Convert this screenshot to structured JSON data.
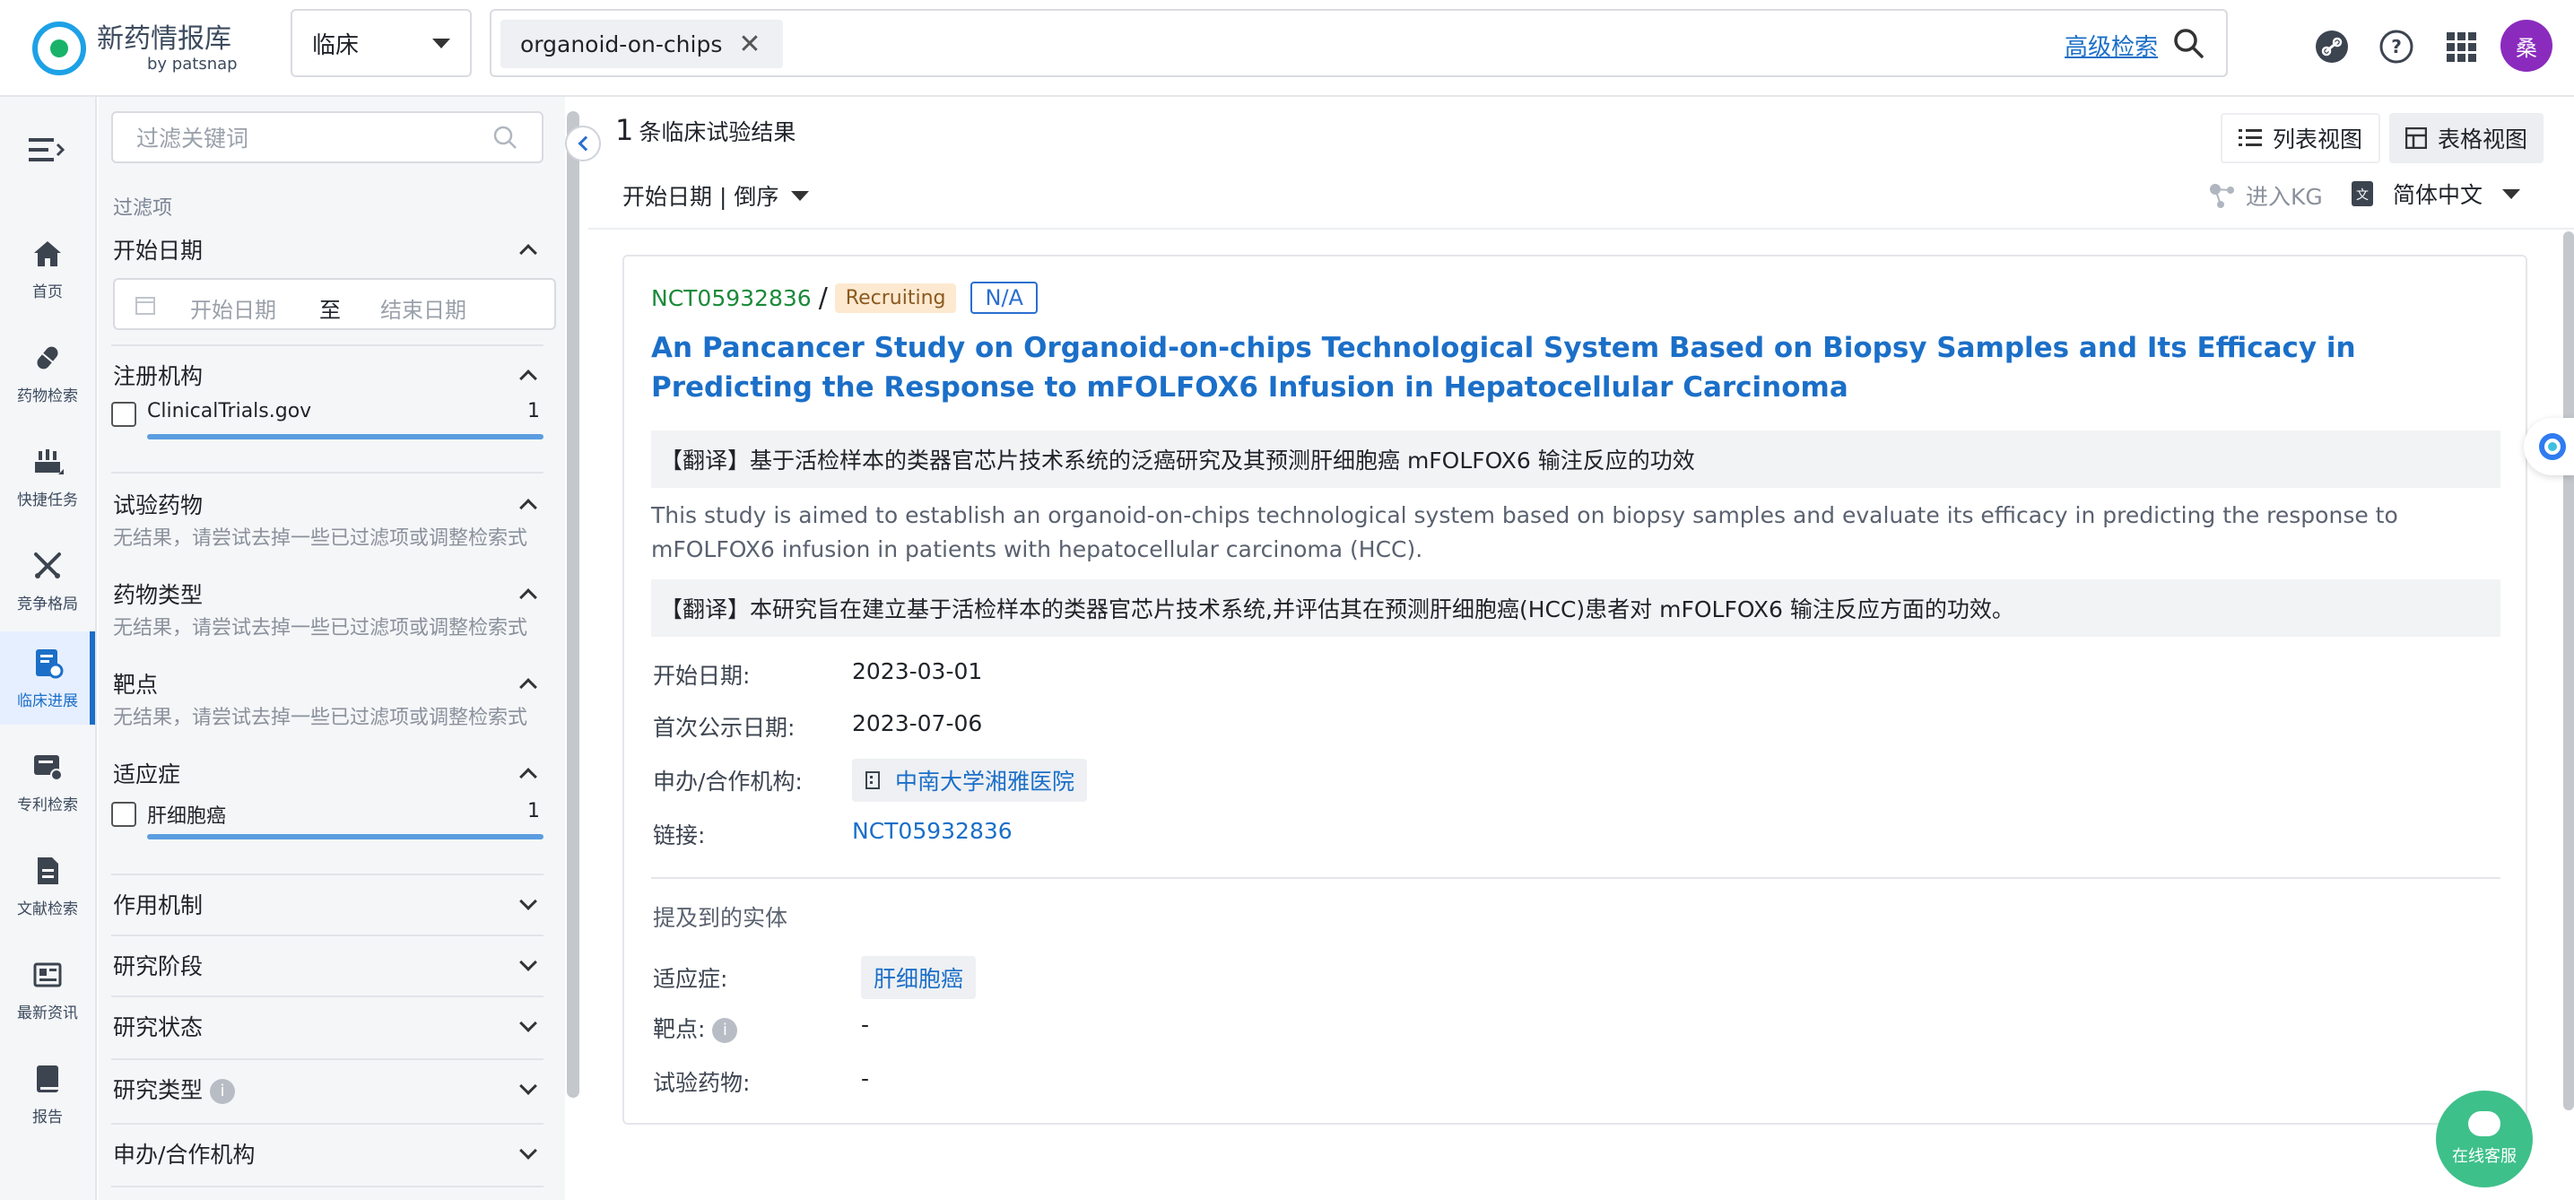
{
  "app": {
    "name": "新药情报库",
    "sub": "by patsnap"
  },
  "topbar": {
    "scope": "临床",
    "query_tag": "organoid-on-chips",
    "advanced_search": "高级检索",
    "avatar": "桑"
  },
  "nav": {
    "items": [
      {
        "label": "首页",
        "icon": "home-icon"
      },
      {
        "label": "药物检索",
        "icon": "pill-icon"
      },
      {
        "label": "快捷任务",
        "icon": "task-icon"
      },
      {
        "label": "竞争格局",
        "icon": "swords-icon"
      },
      {
        "label": "临床进展",
        "icon": "clinical-icon",
        "active": true
      },
      {
        "label": "专利检索",
        "icon": "patent-icon"
      },
      {
        "label": "文献检索",
        "icon": "document-icon"
      },
      {
        "label": "最新资讯",
        "icon": "news-icon"
      },
      {
        "label": "报告",
        "icon": "report-icon"
      }
    ]
  },
  "filter": {
    "keyword_placeholder": "过滤关键词",
    "section_label": "过滤项",
    "start_date": {
      "title": "开始日期",
      "from_placeholder": "开始日期",
      "to": "至",
      "to_placeholder": "结束日期"
    },
    "registry": {
      "title": "注册机构",
      "option": "ClinicalTrials.gov",
      "count": "1"
    },
    "drug": {
      "title": "试验药物",
      "hint": "无结果，请尝试去掉一些已过滤项或调整检索式"
    },
    "drug_type": {
      "title": "药物类型",
      "hint": "无结果，请尝试去掉一些已过滤项或调整检索式"
    },
    "target": {
      "title": "靶点",
      "hint": "无结果，请尝试去掉一些已过滤项或调整检索式"
    },
    "indication": {
      "title": "适应症",
      "option": "肝细胞癌",
      "count": "1"
    },
    "collapsed": [
      "作用机制",
      "研究阶段",
      "研究状态",
      "研究类型",
      "申办/合作机构"
    ]
  },
  "main": {
    "count": "1",
    "count_suffix": "条临床试验结果",
    "list_view": "列表视图",
    "table_view": "表格视图",
    "sort": "开始日期 | 倒序",
    "kg": "进入KG",
    "language": "简体中文"
  },
  "trial": {
    "id": "NCT05932836",
    "status": "Recruiting",
    "phase": "N/A",
    "title": "An Pancancer Study on Organoid-on-chips Technological System Based on Biopsy Samples and Its Efficacy in Predicting the Response to mFOLFOX6 Infusion in Hepatocellular Carcinoma",
    "title_translation": "【翻译】基于活检样本的类器官芯片技术系统的泛癌研究及其预测肝细胞癌 mFOLFOX6 输注反应的功效",
    "abstract": "This study is aimed to establish an organoid-on-chips technological system based on biopsy samples and evaluate its efficacy in predicting the response to mFOLFOX6 infusion in patients with hepatocellular carcinoma (HCC).",
    "abstract_translation": "【翻译】本研究旨在建立基于活检样本的类器官芯片技术系统,并评估其在预测肝细胞癌(HCC)患者对 mFOLFOX6 输注反应方面的功效。",
    "start_label": "开始日期:",
    "start": "2023-03-01",
    "first_posted_label": "首次公示日期:",
    "first_posted": "2023-07-06",
    "sponsor_label": "申办/合作机构:",
    "sponsor": "中南大学湘雅医院",
    "link_label": "链接:",
    "link": "NCT05932836",
    "entities_title": "提及到的实体",
    "indication_label": "适应症:",
    "indication": "肝细胞癌",
    "target_label": "靶点:",
    "target": "-",
    "drug_label": "试验药物:",
    "drug": "-"
  },
  "chat": {
    "label": "在线客服"
  }
}
